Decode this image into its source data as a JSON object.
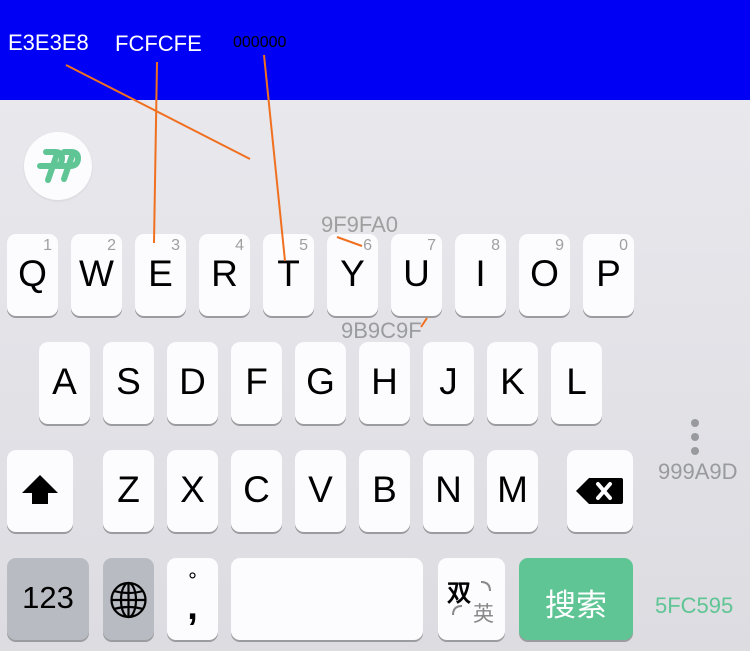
{
  "annotations": {
    "c1": "E3E3E8",
    "c2": "FCFCFE",
    "c3": "000000",
    "c4": "9F9FA0",
    "c5": "9B9C9F",
    "c6": "999A9D",
    "c7": "5FC595"
  },
  "colors": {
    "top_bar": "#0000f5",
    "keyboard_bg": "#e3e3e8",
    "key_bg": "#fcfcfe",
    "key_text": "#000000",
    "key_number": "#9f9fa0",
    "key_shadow": "#9b9c9f",
    "more_dots": "#999a9d",
    "search_green": "#5fc595",
    "annotation_line": "#f07020"
  },
  "app": {
    "logo_icon": "candy-p-logo-icon"
  },
  "row1": [
    {
      "label": "Q",
      "num": "1"
    },
    {
      "label": "W",
      "num": "2"
    },
    {
      "label": "E",
      "num": "3"
    },
    {
      "label": "R",
      "num": "4"
    },
    {
      "label": "T",
      "num": "5"
    },
    {
      "label": "Y",
      "num": "6"
    },
    {
      "label": "U",
      "num": "7"
    },
    {
      "label": "I",
      "num": "8"
    },
    {
      "label": "O",
      "num": "9"
    },
    {
      "label": "P",
      "num": "0"
    }
  ],
  "row2": [
    {
      "label": "A"
    },
    {
      "label": "S"
    },
    {
      "label": "D"
    },
    {
      "label": "F"
    },
    {
      "label": "G"
    },
    {
      "label": "H"
    },
    {
      "label": "J"
    },
    {
      "label": "K"
    },
    {
      "label": "L"
    }
  ],
  "row3": [
    {
      "label": "Z"
    },
    {
      "label": "X"
    },
    {
      "label": "C"
    },
    {
      "label": "V"
    },
    {
      "label": "B"
    },
    {
      "label": "N"
    },
    {
      "label": "M"
    }
  ],
  "bottom": {
    "numbers_label": "123",
    "punct_top": "°",
    "punct_bottom": ",",
    "lang_top": "双",
    "lang_bottom": "英",
    "search_label": "搜索"
  },
  "icons": {
    "shift": "shift-icon",
    "backspace": "backspace-icon",
    "globe": "globe-icon",
    "more": "more-dots-icon"
  }
}
